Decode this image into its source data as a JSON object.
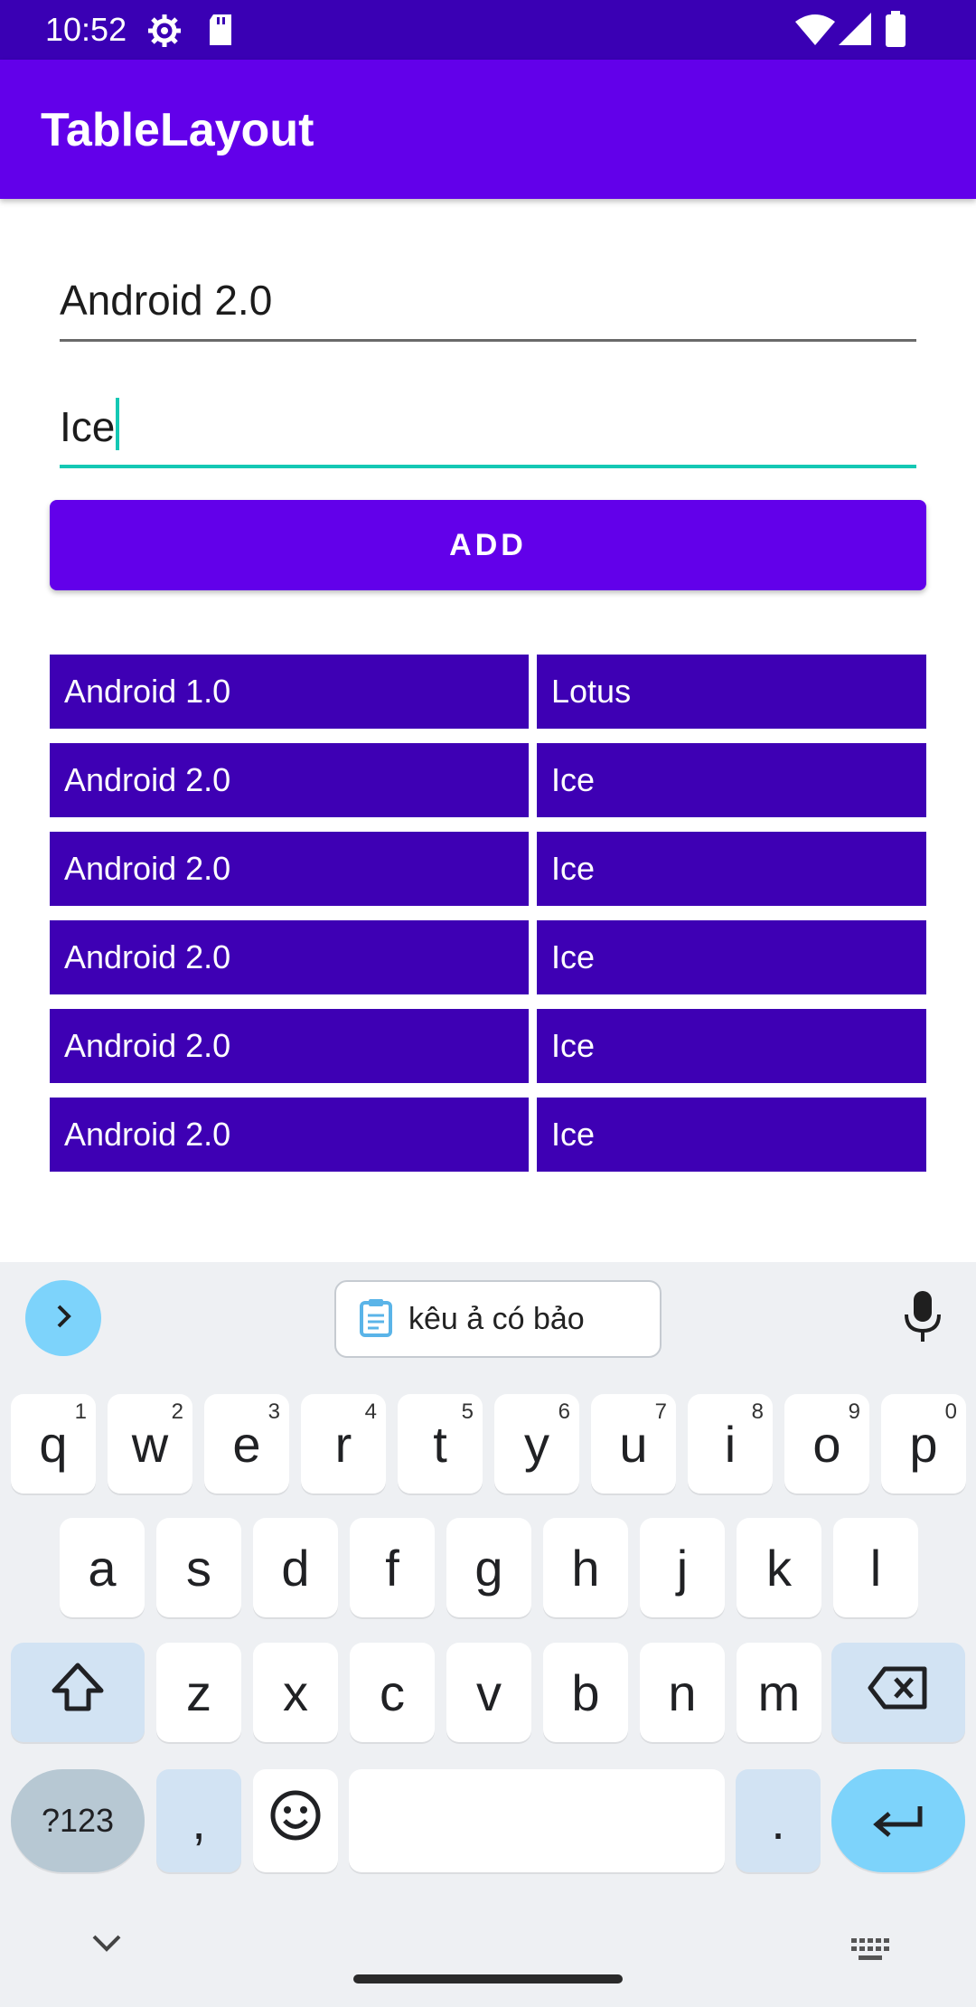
{
  "status_bar": {
    "time": "10:52",
    "left_icons": [
      "settings-icon",
      "sd-card-icon"
    ],
    "right_icons": [
      "wifi-icon",
      "signal-icon",
      "battery-icon"
    ]
  },
  "app_bar": {
    "title": "TableLayout"
  },
  "form": {
    "name_value": "Android 2.0",
    "codename_value": "Ice",
    "add_label": "ADD"
  },
  "table": {
    "rows": [
      {
        "version": "Android 1.0",
        "name": "Lotus"
      },
      {
        "version": "Android 2.0",
        "name": "Ice"
      },
      {
        "version": "Android 2.0",
        "name": "Ice"
      },
      {
        "version": "Android 2.0",
        "name": "Ice"
      },
      {
        "version": "Android 2.0",
        "name": "Ice"
      },
      {
        "version": "Android 2.0",
        "name": "Ice"
      }
    ]
  },
  "keyboard": {
    "suggestion": "kêu ả có bảo",
    "row1": [
      {
        "k": "q",
        "s": "1"
      },
      {
        "k": "w",
        "s": "2"
      },
      {
        "k": "e",
        "s": "3"
      },
      {
        "k": "r",
        "s": "4"
      },
      {
        "k": "t",
        "s": "5"
      },
      {
        "k": "y",
        "s": "6"
      },
      {
        "k": "u",
        "s": "7"
      },
      {
        "k": "i",
        "s": "8"
      },
      {
        "k": "o",
        "s": "9"
      },
      {
        "k": "p",
        "s": "0"
      }
    ],
    "row2": [
      "a",
      "s",
      "d",
      "f",
      "g",
      "h",
      "j",
      "k",
      "l"
    ],
    "row3": [
      "z",
      "x",
      "c",
      "v",
      "b",
      "n",
      "m"
    ],
    "symbols_label": "?123",
    "comma": ",",
    "period": "."
  },
  "colors": {
    "status_bar": "#3a00b4",
    "app_bar": "#6200ea",
    "table_cell": "#3e00b4",
    "focus_accent": "#14c8b4",
    "keyboard_bg": "#eef0f3"
  }
}
